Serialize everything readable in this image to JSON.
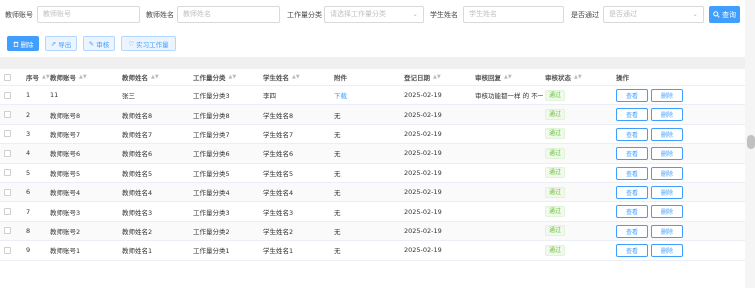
{
  "filters": {
    "teacher_account": {
      "label": "教师账号",
      "placeholder": "教师账号"
    },
    "teacher_name": {
      "label": "教师姓名",
      "placeholder": "教师姓名"
    },
    "workload_category": {
      "label": "工作量分类",
      "placeholder": "请选择工作量分类"
    },
    "student_name": {
      "label": "学生姓名",
      "placeholder": "学生姓名"
    },
    "approved": {
      "label": "是否通过",
      "placeholder": "是否通过"
    },
    "search_label": "查询"
  },
  "toolbar": {
    "delete_label": "删除",
    "export_label": "导出",
    "review_label": "审核",
    "workload_label": "实习工作量"
  },
  "table": {
    "headers": [
      "序号",
      "教师账号",
      "教师姓名",
      "工作量分类",
      "学生姓名",
      "附件",
      "登记日期",
      "审核回复",
      "审核状态",
      "操作"
    ],
    "view_label": "查看",
    "delete_label": "删除",
    "rows": [
      {
        "index": "1",
        "account": "11",
        "name": "张三",
        "category": "工作量分类3",
        "student": "李四",
        "attachment": "下载",
        "date": "2025-02-19",
        "reply": "审核功能都一样 的 不一",
        "status": "通过"
      },
      {
        "index": "2",
        "account": "教师账号8",
        "name": "教师姓名8",
        "category": "工作量分类8",
        "student": "学生姓名8",
        "attachment": "无",
        "date": "2025-02-19",
        "reply": "",
        "status": "通过"
      },
      {
        "index": "3",
        "account": "教师账号7",
        "name": "教师姓名7",
        "category": "工作量分类7",
        "student": "学生姓名7",
        "attachment": "无",
        "date": "2025-02-19",
        "reply": "",
        "status": "通过"
      },
      {
        "index": "4",
        "account": "教师账号6",
        "name": "教师姓名6",
        "category": "工作量分类6",
        "student": "学生姓名6",
        "attachment": "无",
        "date": "2025-02-19",
        "reply": "",
        "status": "通过"
      },
      {
        "index": "5",
        "account": "教师账号5",
        "name": "教师姓名5",
        "category": "工作量分类5",
        "student": "学生姓名5",
        "attachment": "无",
        "date": "2025-02-19",
        "reply": "",
        "status": "通过"
      },
      {
        "index": "6",
        "account": "教师账号4",
        "name": "教师姓名4",
        "category": "工作量分类4",
        "student": "学生姓名4",
        "attachment": "无",
        "date": "2025-02-19",
        "reply": "",
        "status": "通过"
      },
      {
        "index": "7",
        "account": "教师账号3",
        "name": "教师姓名3",
        "category": "工作量分类3",
        "student": "学生姓名3",
        "attachment": "无",
        "date": "2025-02-19",
        "reply": "",
        "status": "通过"
      },
      {
        "index": "8",
        "account": "教师账号2",
        "name": "教师姓名2",
        "category": "工作量分类2",
        "student": "学生姓名2",
        "attachment": "无",
        "date": "2025-02-19",
        "reply": "",
        "status": "通过"
      },
      {
        "index": "9",
        "account": "教师账号1",
        "name": "教师姓名1",
        "category": "工作量分类1",
        "student": "学生姓名1",
        "attachment": "无",
        "date": "2025-02-19",
        "reply": "",
        "status": "通过"
      }
    ]
  },
  "colors": {
    "primary": "#409eff",
    "success": "#67c23a"
  }
}
